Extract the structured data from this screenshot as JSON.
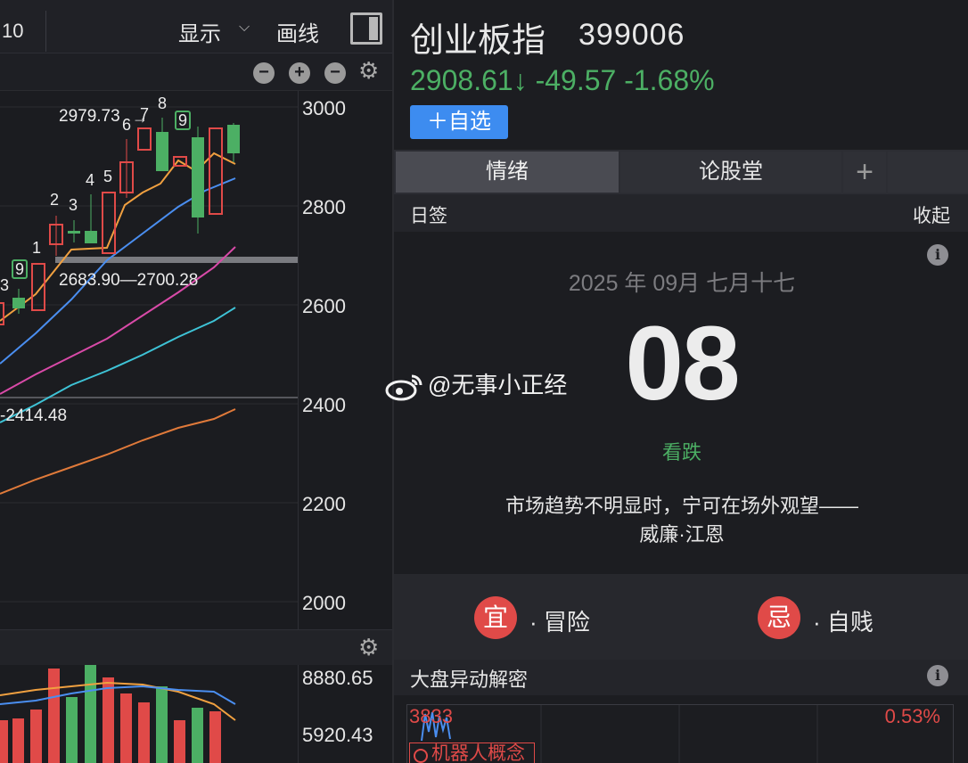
{
  "toolbar": {
    "period_label": "10",
    "show_label": "显示",
    "draw_label": "画线"
  },
  "chart": {
    "axis_labels": [
      "3000",
      "2800",
      "2600",
      "2400",
      "2200",
      "2000"
    ],
    "volume_axis_labels": [
      "8880.65",
      "5920.43"
    ],
    "high_annotation": "2979.73",
    "range_annotation": "2683.90—2700.28",
    "ma_annotation": "-2414.48",
    "count_labels": [
      "1",
      "2",
      "3",
      "4",
      "5",
      "6",
      "7",
      "8",
      "9",
      "9",
      "3"
    ]
  },
  "stock": {
    "name": "创业板指",
    "code": "399006",
    "price": "2908.61↓",
    "change": "-49.57",
    "change_pct": "-1.68%",
    "add_button": "＋自选"
  },
  "tabs": [
    "情绪",
    "论股堂",
    "+"
  ],
  "daily_sign": {
    "title": "日签",
    "collapse": "收起",
    "date_line": "2025 年 09月  七月十七",
    "day": "08",
    "mood": "看跌",
    "quote_line1": "市场趋势不明显时，宁可在场外观望——",
    "quote_line2": "威廉·江恩",
    "yi_char": "宜",
    "yi_text": "冒险",
    "ji_char": "忌",
    "ji_text": "自贱"
  },
  "pan": {
    "title": "大盘异动解密",
    "left_value": "3833",
    "right_value": "0.53%",
    "tag": "机器人概念"
  },
  "watermark": "@无事小正经",
  "colors": {
    "up": "#e04a48",
    "down": "#4caf64",
    "accent": "#3d8cf0"
  }
}
